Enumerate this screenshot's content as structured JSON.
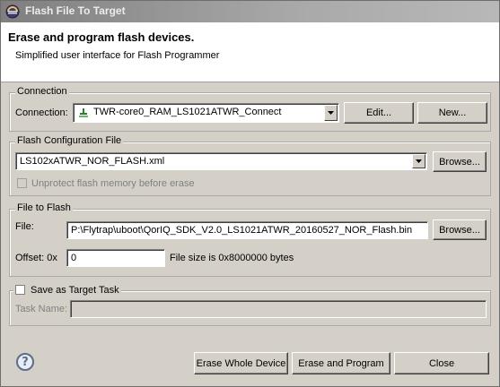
{
  "window": {
    "title": "Flash File To Target",
    "app_icon": "eclipse-icon"
  },
  "banner": {
    "heading": "Erase and program flash devices.",
    "subheading": "Simplified user interface for Flash Programmer"
  },
  "connection": {
    "group_label": "Connection",
    "label": "Connection:",
    "value": "TWR-core0_RAM_LS1021ATWR_Connect",
    "value_icon": "connection-plug-icon",
    "edit_label": "Edit...",
    "new_label": "New..."
  },
  "flash_config": {
    "group_label": "Flash Configuration File",
    "value": "LS102xATWR_NOR_FLASH.xml",
    "browse_label": "Browse...",
    "unprotect_label": "Unprotect flash memory before erase"
  },
  "file_to_flash": {
    "group_label": "File to Flash",
    "file_label": "File:",
    "file_value": "P:\\Flytrap\\uboot\\QorIQ_SDK_V2.0_LS1021ATWR_20160527_NOR_Flash.bin",
    "browse_label": "Browse...",
    "offset_label": "Offset: 0x",
    "offset_value": "0",
    "size_text": "File size is 0x8000000 bytes"
  },
  "target_task": {
    "checkbox_label": "Save as Target Task",
    "task_name_label": "Task Name:",
    "task_name_value": ""
  },
  "footer": {
    "help_glyph": "?",
    "erase_whole_label": "Erase Whole Device",
    "erase_program_label": "Erase and Program",
    "close_label": "Close"
  }
}
